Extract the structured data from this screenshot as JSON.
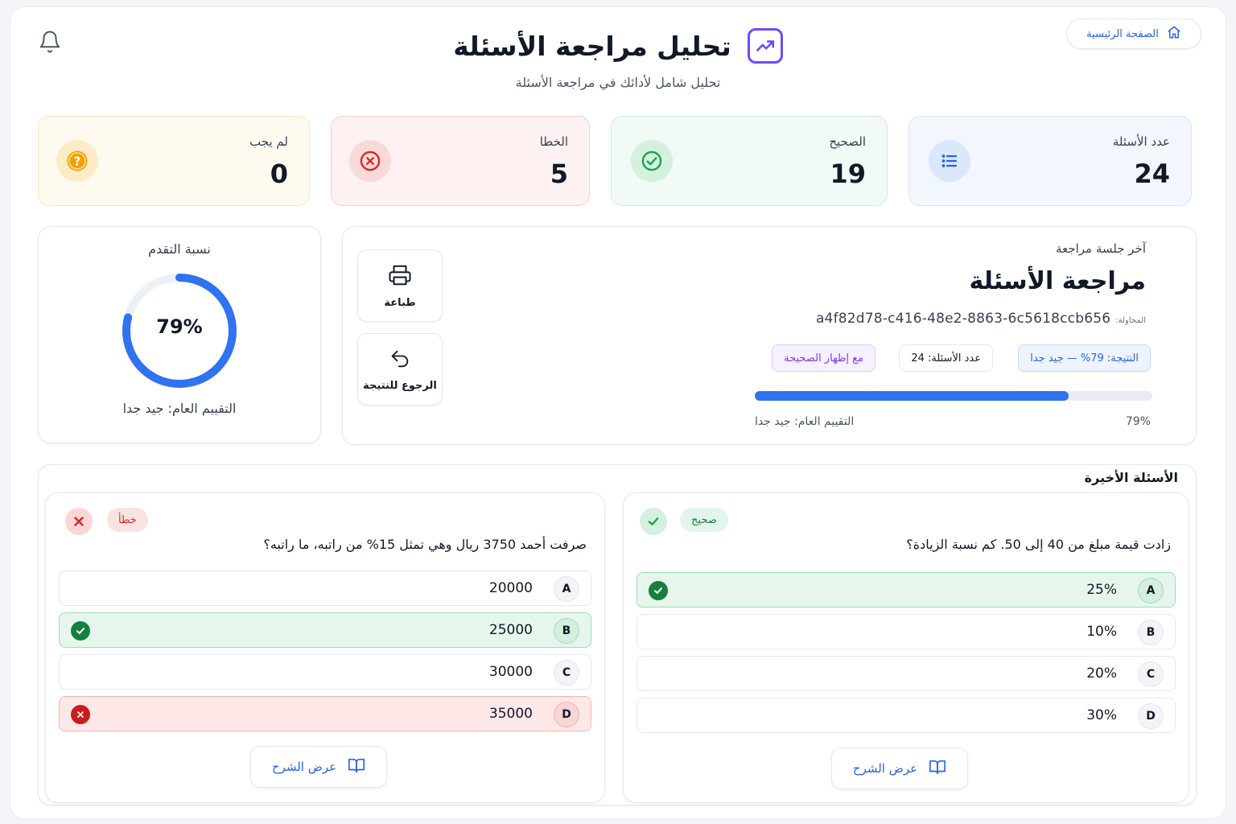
{
  "header": {
    "home_label": "الصفحة الرئيسية",
    "title": "تحليل مراجعة الأسئلة",
    "subtitle": "تحليل شامل لأدائك في مراجعة الأسئلة"
  },
  "stats": [
    {
      "label": "عدد الأسئلة",
      "value": "24",
      "icon": "list-icon",
      "color": "#2563eb"
    },
    {
      "label": "الصحيح",
      "value": "19",
      "icon": "check-circle-icon",
      "color": "#16a34a"
    },
    {
      "label": "الخطا",
      "value": "5",
      "icon": "x-circle-icon",
      "color": "#dc2626"
    },
    {
      "label": "لم يجب",
      "value": "0",
      "icon": "question-circle-icon",
      "color": "#f59e0b"
    }
  ],
  "session": {
    "label": "آخر جلسة مراجعة",
    "title": "مراجعة الأسئلة",
    "attempt_label": "المحاولة:",
    "attempt_id": "a4f82d78-c416-48e2-8863-6c5618ccb656",
    "pills": {
      "result": "النتيجة: 79% — جيد جدا",
      "count": "عدد الأسئلة: 24",
      "mode": "مع إظهار الصحيحة"
    },
    "progress": 0.79,
    "progress_text": "79%",
    "overall": "التقييم العام: جيد جدا",
    "print_label": "طباعة",
    "back_label": "الرجوع للنتيجة"
  },
  "progress_card": {
    "title": "نسبة التقدم",
    "value": 0.79,
    "value_text": "79%",
    "overall": "التقييم العام: جيد جدا"
  },
  "recent": {
    "title": "الأسئلة الأخيرة",
    "questions": [
      {
        "status": "صحيح",
        "text": "زادت قيمة مبلغ من 40 إلى 50.  كم نسبة الزيادة؟",
        "options": [
          {
            "letter": "A",
            "text": "25%",
            "state": "correct"
          },
          {
            "letter": "B",
            "text": "10%",
            "state": "none"
          },
          {
            "letter": "C",
            "text": "20%",
            "state": "none"
          },
          {
            "letter": "D",
            "text": "30%",
            "state": "none"
          }
        ],
        "explain_label": "عرض الشرح"
      },
      {
        "status": "خطأ",
        "text": "صرفت أحمد 3750 ريال وهي تمثل  15% من راتبه، ما راتبه؟",
        "options": [
          {
            "letter": "A",
            "text": "20000",
            "state": "none"
          },
          {
            "letter": "B",
            "text": "25000",
            "state": "correct"
          },
          {
            "letter": "C",
            "text": "30000",
            "state": "none"
          },
          {
            "letter": "D",
            "text": "35000",
            "state": "wrong"
          }
        ],
        "explain_label": "عرض الشرح"
      }
    ]
  },
  "colors": {
    "accent": "#2563eb",
    "success": "#16a34a",
    "danger": "#dc2626",
    "warning": "#f59e0b",
    "brand": "#6d4aff"
  }
}
